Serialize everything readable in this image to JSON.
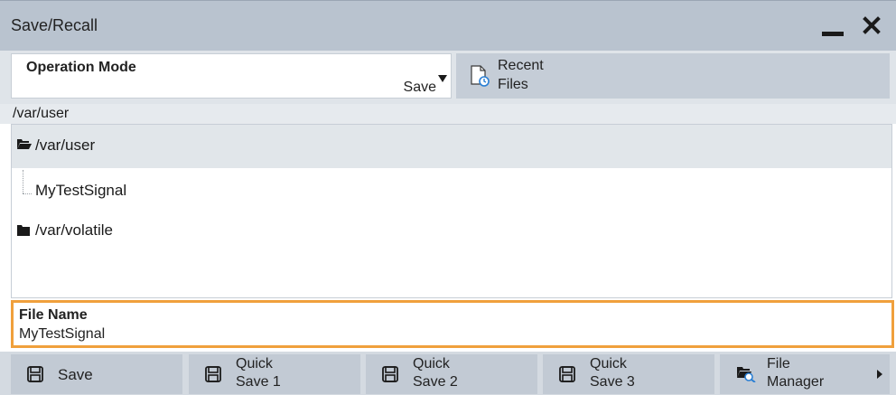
{
  "window": {
    "title": "Save/Recall"
  },
  "operation_mode": {
    "label": "Operation Mode",
    "value": "Save"
  },
  "recent_files": {
    "line1": "Recent",
    "line2": "Files"
  },
  "current_path": "/var/user",
  "tree": {
    "nodes": [
      {
        "label": "/var/user",
        "icon": "folder-open-icon"
      },
      {
        "label": "MyTestSignal",
        "icon": ""
      },
      {
        "label": "/var/volatile",
        "icon": "folder-closed-icon"
      }
    ]
  },
  "file_name": {
    "label": "File Name",
    "value": "MyTestSignal"
  },
  "buttons": {
    "save": {
      "label": "Save",
      "icon": "floppy-disk-icon"
    },
    "quick_save_1": {
      "line1": "Quick",
      "line2": "Save 1",
      "icon": "floppy-disk-icon"
    },
    "quick_save_2": {
      "line1": "Quick",
      "line2": "Save 2",
      "icon": "floppy-disk-icon"
    },
    "quick_save_3": {
      "line1": "Quick",
      "line2": "Save 3",
      "icon": "floppy-disk-icon"
    },
    "file_manager": {
      "line1": "File",
      "line2": "Manager",
      "icon": "folder-search-icon"
    }
  },
  "colors": {
    "title_bar": "#b9c3cf",
    "focus_border": "#f0a03c",
    "button_bg": "#c2cad4",
    "selected_row": "#e1e6ea"
  }
}
